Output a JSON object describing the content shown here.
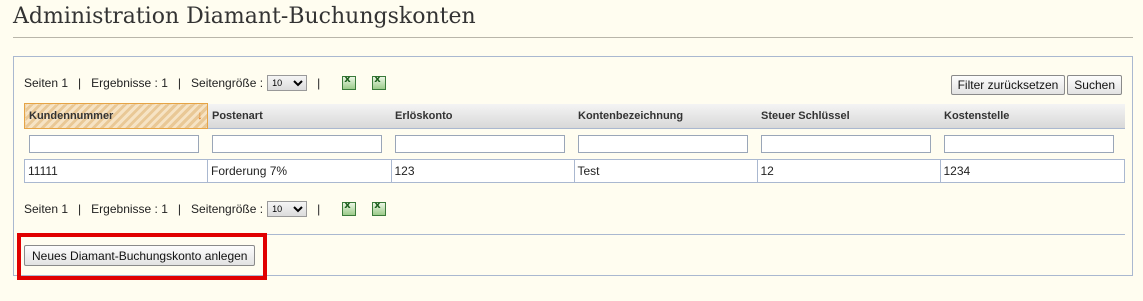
{
  "page": {
    "title": "Administration Diamant-Buchungskonten"
  },
  "pager": {
    "pages": "Seiten 1",
    "separator": "|",
    "results": "Ergebnisse : 1",
    "page_size_label": "Seitengröße :",
    "page_size_value": "10"
  },
  "actions": {
    "reset_filter": "Filter zurücksetzen",
    "search": "Suchen"
  },
  "table": {
    "columns": [
      "Kundennummer",
      "Postenart",
      "Erlöskonto",
      "Kontenbezeichnung",
      "Steuer Schlüssel",
      "Kostenstelle"
    ],
    "sorted_column_indicator": "↓",
    "rows": [
      [
        "11111",
        "Forderung 7%",
        "123",
        "Test",
        "12",
        "1234"
      ]
    ]
  },
  "new_account_button": "Neues Diamant-Buchungskonto anlegen",
  "colors": {
    "highlight": "#e00000",
    "sort_accent": "#e07a16",
    "panel_border": "#aab8d0"
  },
  "icons": {
    "export_1": "excel-export-icon",
    "export_2": "excel-export-icon"
  }
}
